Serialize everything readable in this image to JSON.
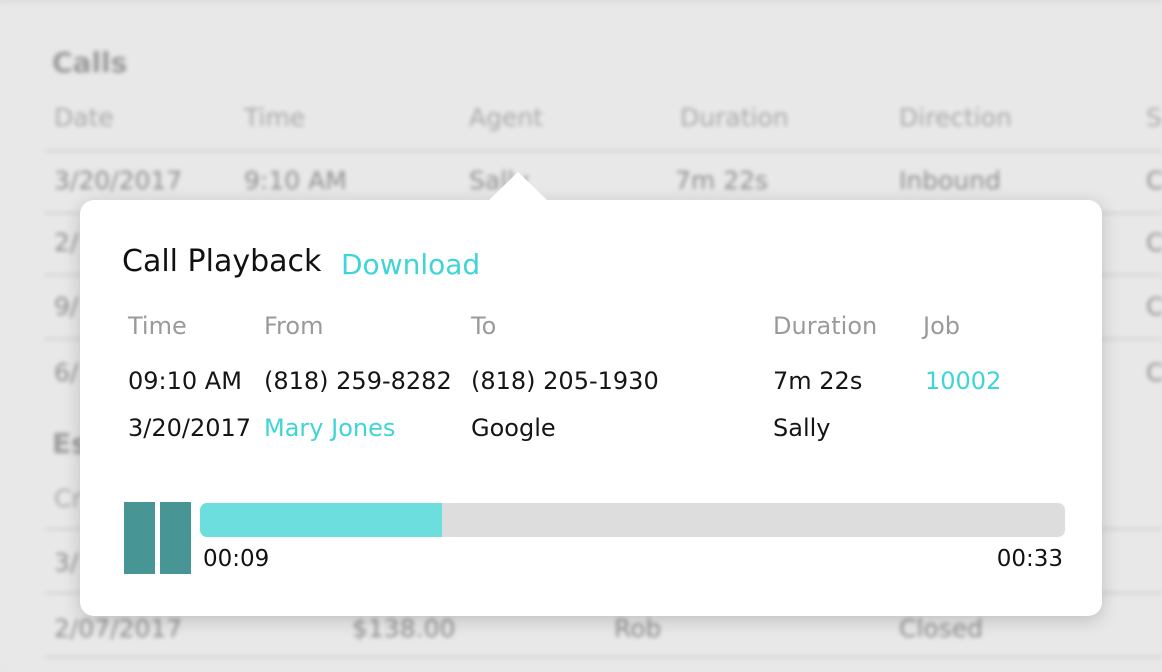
{
  "background": {
    "calls_title": "Calls",
    "calls_headers": [
      "Date",
      "Time",
      "Agent",
      "Duration",
      "Direction",
      "S"
    ],
    "calls_row1": [
      "3/20/2017",
      "9:10 AM",
      "Sally",
      "7m 22s",
      "Inbound",
      "C"
    ],
    "calls_row_fragments": [
      {
        "a": "2/",
        "b": "C"
      },
      {
        "a": "9/",
        "b": "C"
      },
      {
        "a": "6/",
        "b": "C"
      }
    ],
    "section2_fragment": "Es",
    "section2_header_fragment": "Cr",
    "section2_rows": [
      {
        "a": "3/"
      },
      {
        "a": "2/"
      },
      {
        "date": "2/07/2017",
        "amount": "$138.00",
        "agent": "Rob",
        "status": "Closed"
      }
    ]
  },
  "popup": {
    "title": "Call Playback",
    "download_label": "Download",
    "headers": {
      "time": "Time",
      "from": "From",
      "to": "To",
      "duration": "Duration",
      "job": "Job"
    },
    "row1": {
      "time": "09:10 AM",
      "from": "(818) 259-8282",
      "to": "(818) 205-1930",
      "duration": "7m 22s",
      "job": "10002"
    },
    "row2": {
      "date": "3/20/2017",
      "from_name": "Mary Jones",
      "to_name": "Google",
      "agent": "Sally"
    },
    "player": {
      "current_time": "00:09",
      "total_time": "00:33",
      "progress": 0.28,
      "state": "playing",
      "control_icon": "pause-icon"
    }
  },
  "colors": {
    "accent": "#3fd5d8",
    "progress_fill": "#6ddede",
    "pause_button": "#479595",
    "track": "#dddddd"
  }
}
